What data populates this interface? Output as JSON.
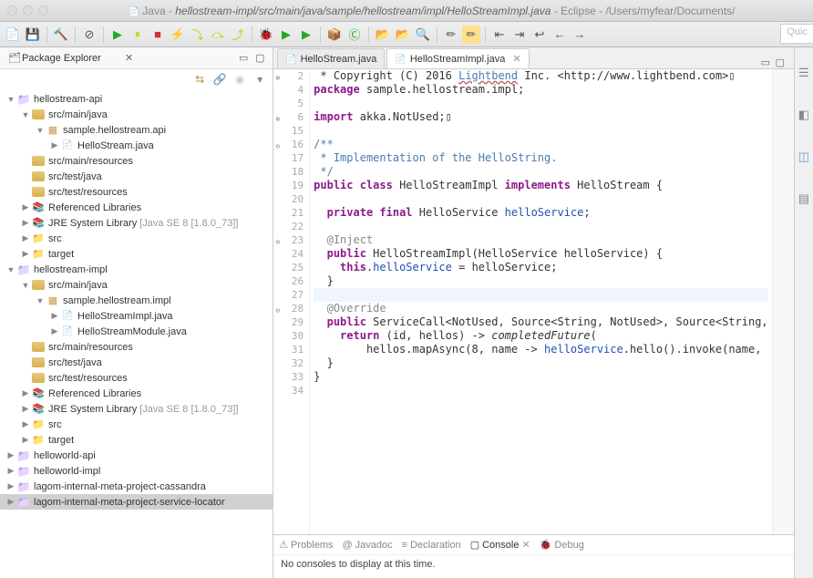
{
  "window": {
    "title_prefix": "Java - ",
    "title_path": "hellostream-impl/src/main/java/sample/hellostream/impl/HelloStreamImpl.java",
    "title_suffix": " - Eclipse - /Users/myfear/Documents/"
  },
  "quick_access": "Quic",
  "package_explorer": {
    "title": "Package Explorer",
    "tree": [
      {
        "d": 0,
        "e": "▼",
        "i": "proj",
        "t": "hellostream-api"
      },
      {
        "d": 1,
        "e": "▼",
        "i": "srcf",
        "t": "src/main/java"
      },
      {
        "d": 2,
        "e": "▼",
        "i": "pkg",
        "t": "sample.hellostream.api"
      },
      {
        "d": 3,
        "e": "▶",
        "i": "jfile",
        "t": "HelloStream.java"
      },
      {
        "d": 1,
        "e": "",
        "i": "srcf",
        "t": "src/main/resources"
      },
      {
        "d": 1,
        "e": "",
        "i": "srcf",
        "t": "src/test/java"
      },
      {
        "d": 1,
        "e": "",
        "i": "srcf",
        "t": "src/test/resources"
      },
      {
        "d": 1,
        "e": "▶",
        "i": "lib",
        "t": "Referenced Libraries"
      },
      {
        "d": 1,
        "e": "▶",
        "i": "lib",
        "t": "JRE System Library",
        "dec": "[Java SE 8 [1.8.0_73]]"
      },
      {
        "d": 1,
        "e": "▶",
        "i": "fold",
        "t": "src"
      },
      {
        "d": 1,
        "e": "▶",
        "i": "fold",
        "t": "target"
      },
      {
        "d": 0,
        "e": "▼",
        "i": "proj",
        "t": "hellostream-impl"
      },
      {
        "d": 1,
        "e": "▼",
        "i": "srcf",
        "t": "src/main/java"
      },
      {
        "d": 2,
        "e": "▼",
        "i": "pkg",
        "t": "sample.hellostream.impl"
      },
      {
        "d": 3,
        "e": "▶",
        "i": "jfile",
        "t": "HelloStreamImpl.java"
      },
      {
        "d": 3,
        "e": "▶",
        "i": "jfile",
        "t": "HelloStreamModule.java"
      },
      {
        "d": 1,
        "e": "",
        "i": "srcf",
        "t": "src/main/resources"
      },
      {
        "d": 1,
        "e": "",
        "i": "srcf",
        "t": "src/test/java"
      },
      {
        "d": 1,
        "e": "",
        "i": "srcf",
        "t": "src/test/resources"
      },
      {
        "d": 1,
        "e": "▶",
        "i": "lib",
        "t": "Referenced Libraries"
      },
      {
        "d": 1,
        "e": "▶",
        "i": "lib",
        "t": "JRE System Library",
        "dec": "[Java SE 8 [1.8.0_73]]"
      },
      {
        "d": 1,
        "e": "▶",
        "i": "fold",
        "t": "src"
      },
      {
        "d": 1,
        "e": "▶",
        "i": "fold",
        "t": "target"
      },
      {
        "d": 0,
        "e": "▶",
        "i": "proj",
        "t": "helloworld-api"
      },
      {
        "d": 0,
        "e": "▶",
        "i": "proj",
        "t": "helloworld-impl"
      },
      {
        "d": 0,
        "e": "▶",
        "i": "proj",
        "t": "lagom-internal-meta-project-cassandra"
      },
      {
        "d": 0,
        "e": "▶",
        "i": "proj",
        "t": "lagom-internal-meta-project-service-locator",
        "sel": true
      }
    ]
  },
  "editor": {
    "tabs": [
      {
        "label": "HelloStream.java",
        "active": false
      },
      {
        "label": "HelloStreamImpl.java",
        "active": true
      }
    ],
    "lines": [
      {
        "n": "2",
        "fold": "⊕",
        "html": " * Copyright (C) 2016 <span class='url'>Lightbend</span> Inc. &lt;http://www.lightbend.com&gt;▯"
      },
      {
        "n": "4",
        "html": "<span class='kw'>package</span> sample.hellostream.impl;"
      },
      {
        "n": "5",
        "html": ""
      },
      {
        "n": "6",
        "fold": "⊕",
        "html": "<span class='kw'>import</span> akka.NotUsed;▯"
      },
      {
        "n": "15",
        "html": ""
      },
      {
        "n": "16",
        "fold": "⊖",
        "html": "<span class='com'>/**</span>"
      },
      {
        "n": "17",
        "html": "<span class='com'> * Implementation of the HelloString.</span>"
      },
      {
        "n": "18",
        "html": "<span class='com'> */</span>"
      },
      {
        "n": "19",
        "html": "<span class='kw'>public class</span> HelloStreamImpl <span class='kw'>implements</span> HelloStream {"
      },
      {
        "n": "20",
        "html": ""
      },
      {
        "n": "21",
        "html": "  <span class='kw'>private final</span> HelloService <span class='field'>helloService</span>;"
      },
      {
        "n": "22",
        "html": ""
      },
      {
        "n": "23",
        "fold": "⊖",
        "html": "  <span class='ann'>@Inject</span>"
      },
      {
        "n": "24",
        "html": "  <span class='kw'>public</span> HelloStreamImpl(HelloService helloService) {"
      },
      {
        "n": "25",
        "html": "    <span class='kw'>this</span>.<span class='field'>helloService</span> = helloService;"
      },
      {
        "n": "26",
        "html": "  }"
      },
      {
        "n": "27",
        "hl": true,
        "html": ""
      },
      {
        "n": "28",
        "fold": "⊖",
        "html": "  <span class='ann'>@Override</span>"
      },
      {
        "n": "29",
        "html": "  <span class='kw'>public</span> ServiceCall&lt;NotUsed, Source&lt;String, NotUsed&gt;, Source&lt;String,"
      },
      {
        "n": "30",
        "html": "    <span class='kw'>return</span> (id, hellos) -&gt; <span class='meth'>completedFuture</span>("
      },
      {
        "n": "31",
        "html": "        hellos.mapAsync(8, name -&gt; <span class='field'>helloService</span>.hello().invoke(name, <span></span>"
      },
      {
        "n": "32",
        "html": "  }"
      },
      {
        "n": "33",
        "html": "}"
      },
      {
        "n": "34",
        "html": ""
      }
    ]
  },
  "bottom": {
    "tabs": [
      "Problems",
      "Javadoc",
      "Declaration",
      "Console",
      "Debug"
    ],
    "active": 3,
    "console_text": "No consoles to display at this time."
  }
}
